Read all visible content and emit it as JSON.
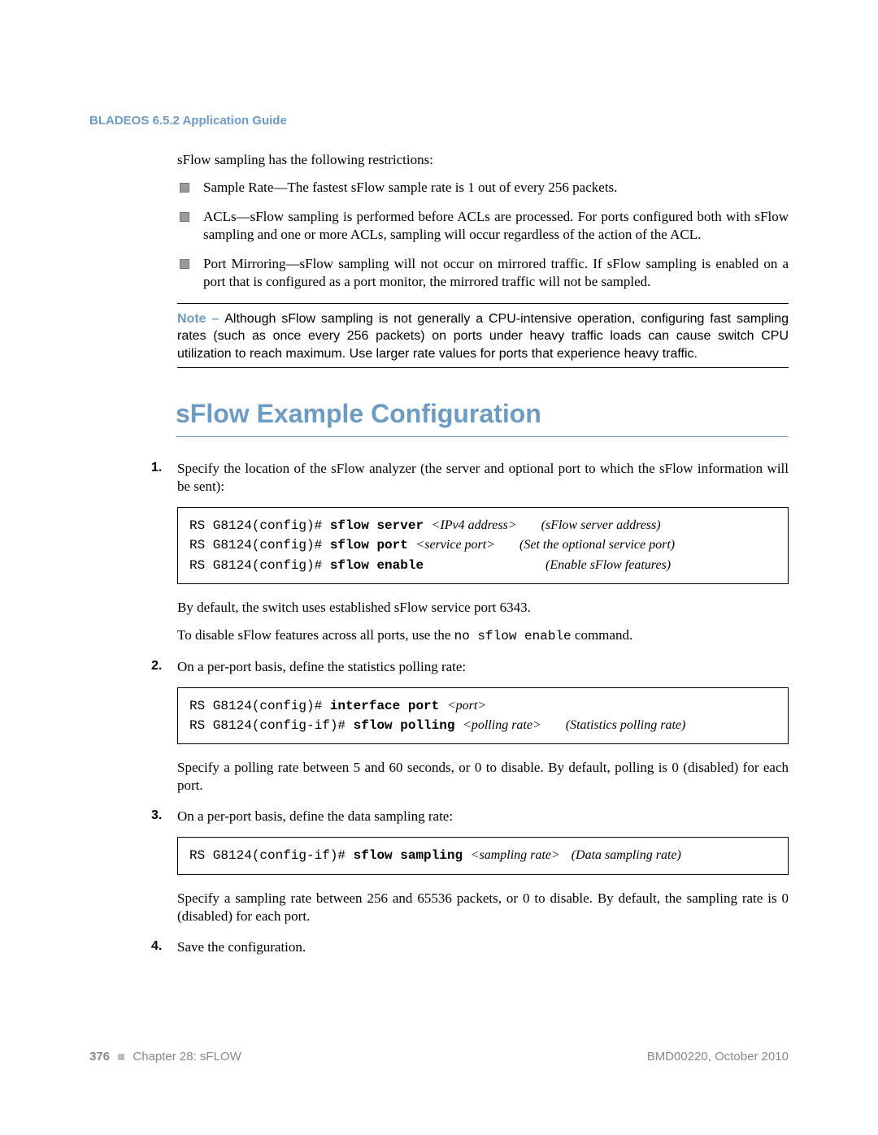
{
  "header": {
    "title": "BLADEOS 6.5.2 Application Guide"
  },
  "body": {
    "intro": "sFlow sampling has the following restrictions:",
    "bullets": [
      "Sample Rate—The fastest sFlow sample rate is 1 out of every 256 packets.",
      "ACLs—sFlow sampling is performed before ACLs are processed. For ports configured both with sFlow sampling and one or more ACLs, sampling will occur regardless of the action of the ACL.",
      "Port Mirroring—sFlow sampling will not occur on mirrored traffic. If sFlow sampling is enabled on a port that is configured as a port monitor, the mirrored traffic will not be sampled."
    ],
    "note": {
      "label": "Note – ",
      "text": "Although sFlow sampling is not generally a CPU-intensive operation, configuring fast sampling rates (such as once every 256 packets) on ports under heavy traffic loads can cause switch CPU utilization to reach maximum. Use larger rate values for ports that experience heavy traffic."
    },
    "section_title": "sFlow Example Configuration",
    "steps": [
      {
        "num": "1.",
        "lead": "Specify the location of the sFlow analyzer (the server and optional port to which the sFlow information will be sent):",
        "cmd": [
          {
            "prompt": "RS G8124(config)# ",
            "bold": "sflow server ",
            "arg": "<IPv4 address>",
            "desc": "(sFlow server address)"
          },
          {
            "prompt": "RS G8124(config)# ",
            "bold": "sflow port ",
            "arg": "<service port>",
            "desc": "(Set the optional service port)"
          },
          {
            "prompt": "RS G8124(config)# ",
            "bold": "sflow enable",
            "arg": "",
            "desc": "(Enable sFlow features)"
          }
        ],
        "after1": "By default, the switch uses established sFlow service port 6343.",
        "after2a": "To disable sFlow features across all ports, use the ",
        "after2b": "no sflow enable",
        "after2c": " command."
      },
      {
        "num": "2.",
        "lead": "On a per-port basis, define the statistics polling rate:",
        "cmd": [
          {
            "prompt": "RS G8124(config)# ",
            "bold": "interface port ",
            "arg": "<port>",
            "desc": ""
          },
          {
            "prompt": "RS G8124(config-if)# ",
            "bold": "sflow polling ",
            "arg": "<polling rate>",
            "desc": "(Statistics polling rate)"
          }
        ],
        "after1": "Specify a polling rate between 5 and 60 seconds, or 0 to disable. By default, polling is 0 (disabled) for each port."
      },
      {
        "num": "3.",
        "lead": "On a per-port basis, define the data sampling rate:",
        "cmd": [
          {
            "prompt": "RS G8124(config-if)# ",
            "bold": "sflow sampling ",
            "arg": "<sampling rate>",
            "desc": "(Data sampling rate)"
          }
        ],
        "after1": "Specify a sampling rate between 256 and 65536 packets, or 0 to disable. By default, the sampling rate is 0 (disabled) for each port."
      },
      {
        "num": "4.",
        "lead": "Save the configuration."
      }
    ]
  },
  "footer": {
    "page": "376",
    "chapter": "Chapter 28: sFLOW",
    "docref": "BMD00220, October 2010"
  }
}
